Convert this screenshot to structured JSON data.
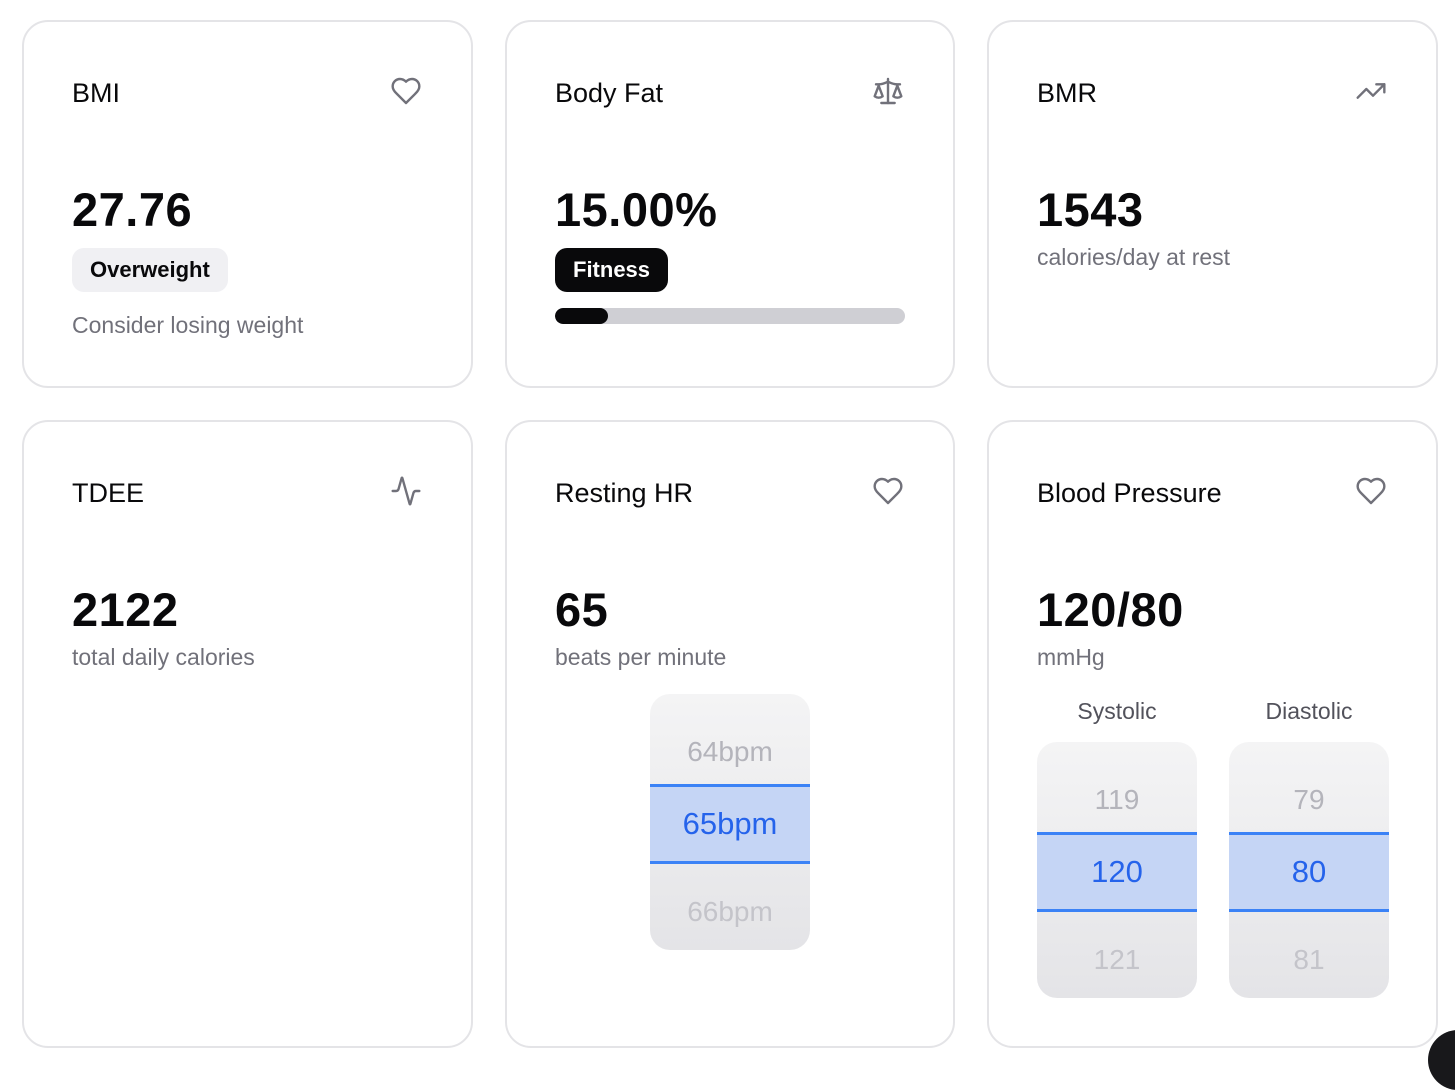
{
  "cards": {
    "bmi": {
      "title": "BMI",
      "icon": "heart-icon",
      "value": "27.76",
      "badge": "Overweight",
      "hint": "Consider losing weight"
    },
    "body_fat": {
      "title": "Body Fat",
      "icon": "scale-icon",
      "value": "15.00%",
      "badge": "Fitness",
      "progress_percent": 15
    },
    "bmr": {
      "title": "BMR",
      "icon": "trending-up-icon",
      "value": "1543",
      "sub": "calories/day at rest"
    },
    "tdee": {
      "title": "TDEE",
      "icon": "activity-icon",
      "value": "2122",
      "sub": "total daily calories"
    },
    "resting_hr": {
      "title": "Resting HR",
      "icon": "heart-icon",
      "value": "65",
      "sub": "beats per minute",
      "picker": [
        "64bpm",
        "65bpm",
        "66bpm"
      ]
    },
    "blood_pressure": {
      "title": "Blood Pressure",
      "icon": "heart-icon",
      "value": "120/80",
      "sub": "mmHg",
      "systolic_label": "Systolic",
      "diastolic_label": "Diastolic",
      "systolic_picker": [
        "119",
        "120",
        "121"
      ],
      "diastolic_picker": [
        "79",
        "80",
        "81"
      ]
    }
  }
}
